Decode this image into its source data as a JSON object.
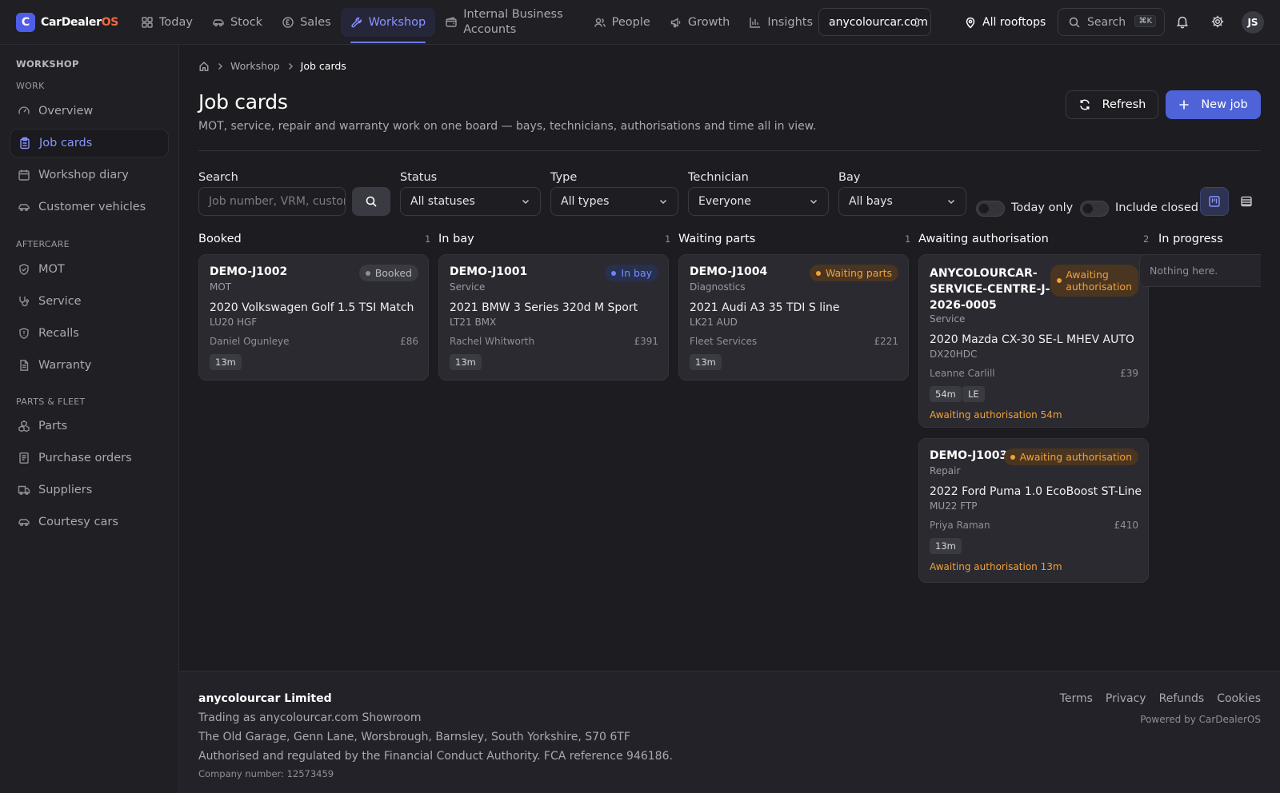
{
  "brand": {
    "name": "CarDealer",
    "suffix": "OS",
    "logo_letter": "C"
  },
  "nav": {
    "items": [
      {
        "label": "Today",
        "icon": "grid-icon"
      },
      {
        "label": "Stock",
        "icon": "car-icon"
      },
      {
        "label": "Sales",
        "icon": "coin-icon"
      },
      {
        "label": "Workshop",
        "icon": "wrench-icon",
        "active": true
      },
      {
        "label": "Internal Business Accounts",
        "label_line1": "Internal Business",
        "label_line2": "Accounts",
        "icon": "wallet-icon"
      },
      {
        "label": "People",
        "icon": "users-icon"
      },
      {
        "label": "Growth",
        "icon": "megaphone-icon"
      },
      {
        "label": "Insights",
        "icon": "bar-chart-icon"
      }
    ],
    "domain": "anycolourcar.com",
    "rooftops": "All rooftops",
    "search_placeholder": "Search",
    "search_shortcut": "⌘K",
    "avatar_initials": "JS"
  },
  "sidebar": {
    "title": "WORKSHOP",
    "sections": [
      {
        "heading": "WORK",
        "items": [
          {
            "label": "Overview",
            "icon": "gauge-icon"
          },
          {
            "label": "Job cards",
            "icon": "clipboard-icon",
            "active": true
          },
          {
            "label": "Workshop diary",
            "icon": "calendar-icon"
          },
          {
            "label": "Customer vehicles",
            "icon": "car-icon"
          }
        ]
      },
      {
        "heading": "AFTERCARE",
        "items": [
          {
            "label": "MOT",
            "icon": "shield-check-icon"
          },
          {
            "label": "Service",
            "icon": "stethoscope-icon"
          },
          {
            "label": "Recalls",
            "icon": "shield-alert-icon"
          },
          {
            "label": "Warranty",
            "icon": "document-icon"
          }
        ]
      },
      {
        "heading": "PARTS & FLEET",
        "items": [
          {
            "label": "Parts",
            "icon": "boxes-icon"
          },
          {
            "label": "Purchase orders",
            "icon": "receipt-icon"
          },
          {
            "label": "Suppliers",
            "icon": "truck-icon"
          },
          {
            "label": "Courtesy cars",
            "icon": "car-icon"
          }
        ]
      }
    ]
  },
  "breadcrumb": {
    "home_icon": "home-icon",
    "parent": "Workshop",
    "current": "Job cards"
  },
  "page": {
    "title": "Job cards",
    "subtitle": "MOT, service, repair and warranty work on one board — bays, technicians, authorisations and time all in view.",
    "refresh_label": "Refresh",
    "new_job_label": "New job"
  },
  "filters": {
    "search_label": "Search",
    "search_placeholder": "Job number, VRM, customer",
    "status_label": "Status",
    "status_value": "All statuses",
    "type_label": "Type",
    "type_value": "All types",
    "technician_label": "Technician",
    "technician_value": "Everyone",
    "bay_label": "Bay",
    "bay_value": "All bays",
    "today_only_label": "Today only",
    "today_only": false,
    "include_closed_label": "Include closed",
    "include_closed": false,
    "view_mode": "board"
  },
  "board": {
    "columns": [
      {
        "title": "Booked",
        "count": "1",
        "cards": [
          {
            "job": "DEMO-J1002",
            "status": "Booked",
            "type": "MOT",
            "vehicle": "2020 Volkswagen Golf 1.5 TSI Match",
            "vrm": "LU20 HGF",
            "customer": "Daniel Ogunleye",
            "price": "£86",
            "chips": [
              "13m"
            ]
          }
        ]
      },
      {
        "title": "In bay",
        "count": "1",
        "cards": [
          {
            "job": "DEMO-J1001",
            "status": "In bay",
            "type": "Service",
            "vehicle": "2021 BMW 3 Series 320d M Sport",
            "vrm": "LT21 BMX",
            "customer": "Rachel Whitworth",
            "price": "£391",
            "chips": [
              "13m"
            ]
          }
        ]
      },
      {
        "title": "Waiting parts",
        "count": "1",
        "cards": [
          {
            "job": "DEMO-J1004",
            "status": "Waiting parts",
            "type": "Diagnostics",
            "vehicle": "2021 Audi A3 35 TDI S line",
            "vrm": "LK21 AUD",
            "customer": "Fleet Services",
            "price": "£221",
            "chips": [
              "13m"
            ]
          }
        ]
      },
      {
        "title": "Awaiting authorisation",
        "count": "2",
        "cards": [
          {
            "job": "ANYCOLOURCAR-SERVICE-CENTRE-J-2026-0005",
            "job_lines": [
              "ANYCOLOURCAR-",
              "SERVICE-CENTRE-J-",
              "2026-0005"
            ],
            "status": "Awaiting authorisation",
            "status_lines": [
              "Awaiting",
              "authorisation"
            ],
            "type": "Service",
            "vehicle": "2020 Mazda CX-30 SE-L MHEV AUTO",
            "vrm": "DX20HDC",
            "customer": "Leanne Carlill",
            "price": "£39",
            "chips": [
              "54m",
              "LE"
            ],
            "note": "Awaiting authorisation 54m"
          },
          {
            "job": "DEMO-J1003",
            "status": "Awaiting authorisation",
            "type": "Repair",
            "vehicle": "2022 Ford Puma 1.0 EcoBoost ST-Line",
            "vrm": "MU22 FTP",
            "customer": "Priya Raman",
            "price": "£410",
            "chips": [
              "13m"
            ],
            "note": "Awaiting authorisation 13m"
          }
        ]
      },
      {
        "title": "In progress",
        "count": "",
        "empty_text": "Nothing here."
      }
    ]
  },
  "footer": {
    "company": "anycolourcar Limited",
    "trading": "Trading as anycolourcar.com Showroom",
    "address": "The Old Garage, Genn Lane, Worsbrough, Barnsley, South Yorkshire, S70 6TF",
    "regulation": "Authorised and regulated by the Financial Conduct Authority. FCA reference 946186.",
    "company_number": "Company number: 12573459",
    "links": [
      "Terms",
      "Privacy",
      "Refunds",
      "Cookies"
    ],
    "powered_by": "Powered by CarDealerOS"
  },
  "colors": {
    "accent": "#4f63d9",
    "warning": "#f1a13a",
    "in_bay": "#7b8dff"
  }
}
